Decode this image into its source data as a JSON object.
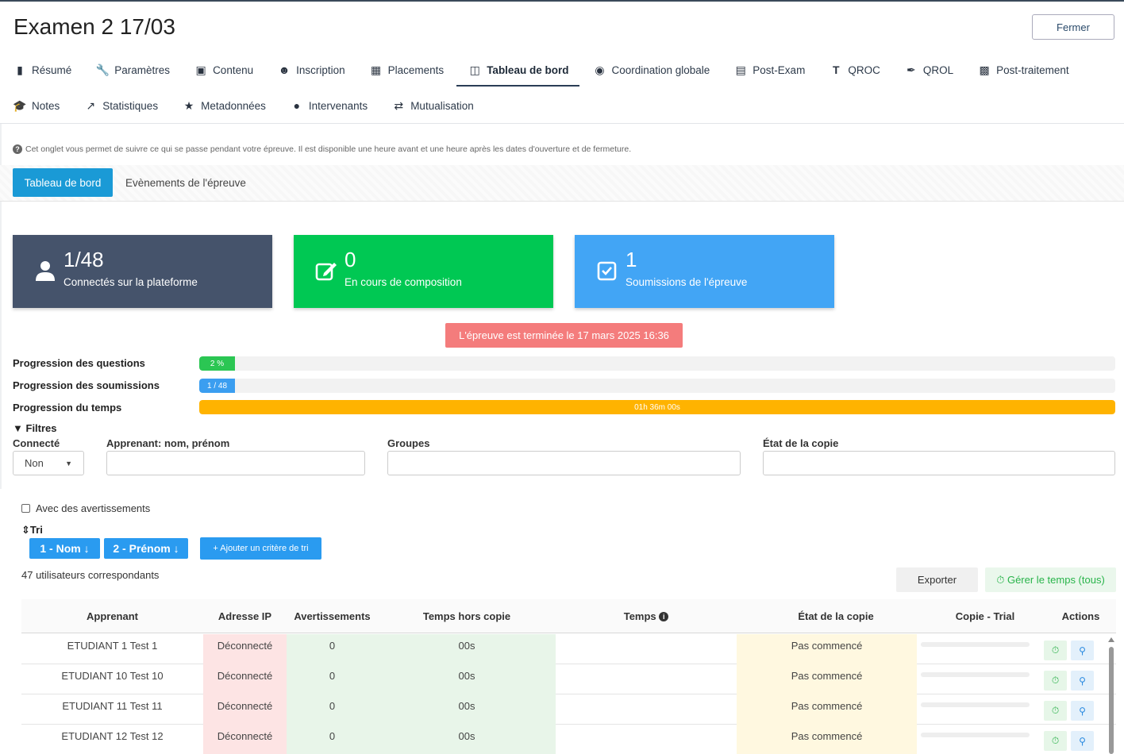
{
  "header": {
    "title": "Examen 2 17/03",
    "close_label": "Fermer"
  },
  "tabs_row1": [
    {
      "label": "Résumé",
      "icon": "bookmark-icon"
    },
    {
      "label": "Paramètres",
      "icon": "wrench-icon"
    },
    {
      "label": "Contenu",
      "icon": "book-icon"
    },
    {
      "label": "Inscription",
      "icon": "users-icon"
    },
    {
      "label": "Placements",
      "icon": "grid-icon"
    },
    {
      "label": "Tableau de bord",
      "icon": "dashboard-icon",
      "active": true
    },
    {
      "label": "Coordination globale",
      "icon": "globe-icon"
    },
    {
      "label": "Post-Exam",
      "icon": "server-icon"
    },
    {
      "label": "QROC",
      "icon": "text-height-icon"
    },
    {
      "label": "QROL",
      "icon": "pen-nib-icon"
    },
    {
      "label": "Post-traitement",
      "icon": "toolbox-icon"
    }
  ],
  "tabs_row2": [
    {
      "label": "Notes",
      "icon": "graduation-cap-icon"
    },
    {
      "label": "Statistiques",
      "icon": "chart-line-icon"
    },
    {
      "label": "Metadonnées",
      "icon": "star-icon"
    },
    {
      "label": "Intervenants",
      "icon": "user-icon"
    },
    {
      "label": "Mutualisation",
      "icon": "exchange-icon"
    }
  ],
  "info": "Cet onglet vous permet de suivre ce qui se passe pendant votre épreuve. Il est disponible une heure avant et une heure après les dates d'ouverture et de fermeture.",
  "subtabs": {
    "active": "Tableau de bord",
    "other": "Evènements de l'épreuve"
  },
  "cards": [
    {
      "value": "1/48",
      "label": "Connectés sur la plateforme",
      "icon": "user-icon",
      "color": "#45536b"
    },
    {
      "value": "0",
      "label": "En cours de composition",
      "icon": "edit-icon",
      "color": "#00c853"
    },
    {
      "value": "1",
      "label": "Soumissions de l'épreuve",
      "icon": "check-square-icon",
      "color": "#42a5f5"
    }
  ],
  "ended_banner": "L'épreuve est terminée le 17 mars 2025 16:36",
  "progress": [
    {
      "label": "Progression des questions",
      "text": "2 %",
      "fraction": 0.02,
      "color": "#2bc653"
    },
    {
      "label": "Progression des soumissions",
      "text": "1 / 48",
      "fraction": 0.0208,
      "color": "#3b9ef0"
    },
    {
      "label": "Progression du temps",
      "text": "01h 36m 00s",
      "fraction": 1.0,
      "color": "#ffb300"
    }
  ],
  "filters": {
    "title": "Filtres",
    "connected_label": "Connecté",
    "connected_value": "Non",
    "learner_label": "Apprenant: nom, prénom",
    "groups_label": "Groupes",
    "state_label": "État de la copie",
    "warnings_label": "Avec des avertissements"
  },
  "sort": {
    "title": "Tri",
    "criteria": [
      "1 - Nom",
      "2 - Prénom"
    ],
    "add_label": "+ Ajouter un critère de tri"
  },
  "results": {
    "count": "47 utilisateurs correspondants",
    "export_label": "Exporter",
    "manage_time_label": "Gérer le temps (tous)"
  },
  "table": {
    "columns": [
      "Apprenant",
      "Adresse IP",
      "Avertissements",
      "Temps hors copie",
      "Temps",
      "État de la copie",
      "Copie - Trial",
      "Actions"
    ],
    "rows": [
      {
        "name": "ETUDIANT 1 Test 1",
        "ip": "Déconnecté",
        "warnings": "0",
        "offtime": "00s",
        "time": "",
        "state": "Pas commencé"
      },
      {
        "name": "ETUDIANT 10 Test 10",
        "ip": "Déconnecté",
        "warnings": "0",
        "offtime": "00s",
        "time": "",
        "state": "Pas commencé"
      },
      {
        "name": "ETUDIANT 11 Test 11",
        "ip": "Déconnecté",
        "warnings": "0",
        "offtime": "00s",
        "time": "",
        "state": "Pas commencé"
      },
      {
        "name": "ETUDIANT 12 Test 12",
        "ip": "Déconnecté",
        "warnings": "0",
        "offtime": "00s",
        "time": "",
        "state": "Pas commencé"
      }
    ]
  }
}
